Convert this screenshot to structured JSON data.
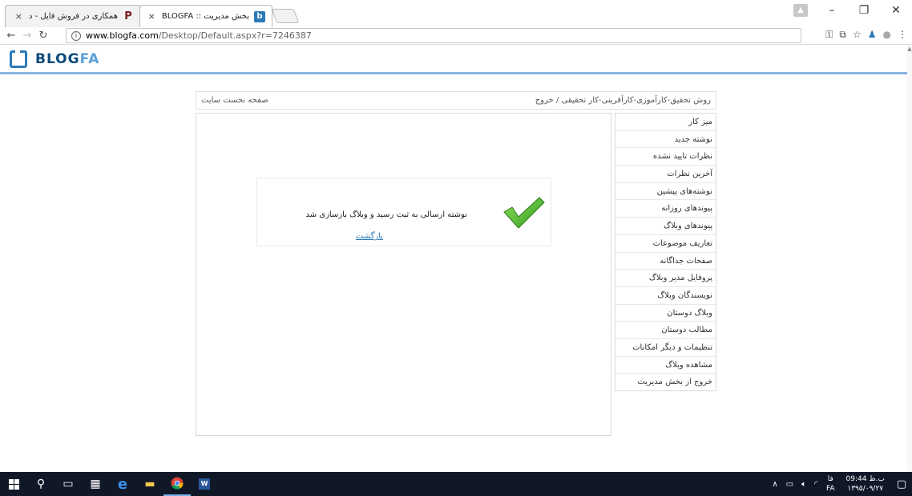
{
  "browser": {
    "tabs": [
      {
        "title": "همکاری در فروش فایل - د",
        "icon": "P",
        "close": "×"
      },
      {
        "title": "بخش مدیریت :: BLOGFA",
        "icon": "b",
        "close": "×"
      }
    ],
    "address": {
      "host": "www.blogfa.com",
      "path": "/Desktop/Default.aspx?r=7246387"
    },
    "window_controls": {
      "minimize": "–",
      "maximize": "❐",
      "close": "✕"
    }
  },
  "site": {
    "logo_blog": "BLOG",
    "logo_fa": "FA"
  },
  "topbar": {
    "blog_title": "روش تحقیق-کارآموزی-کارآفرینی-کار تحقیقی",
    "separator": "/",
    "logout": "خروج",
    "site_home": "صفحه نخست سایت"
  },
  "message": {
    "text": "نوشته ارسالی به ثبت رسید و وبلاگ بازسازی شد",
    "back": "بازگشت"
  },
  "sidebar": {
    "items": [
      "میز کار",
      "نوشته جدید",
      "نظرات تایید نشده",
      "آخرین نظرات",
      "نوشته‌های پیشین",
      "پیوندهای روزانه",
      "پیوندهای وبلاگ",
      "تعاریف موضوعات",
      "صفحات جداگانه",
      "پروفایل مدیر وبلاگ",
      "نویسندگان وبلاگ",
      "وبلاگ دوستان",
      "مطالب دوستان",
      "تنظیمات و دیگر امکانات",
      "مشاهده وبلاگ",
      "خروج از بخش مدیریت"
    ]
  },
  "taskbar": {
    "time": "09:44 ب.ظ",
    "date": "۱۳۹۵/۰۹/۲۷",
    "lang_top": "فا",
    "lang_bottom": "FA"
  },
  "colors": {
    "accent": "#2a7ab8",
    "header_line": "#8ab4e0",
    "taskbar": "#101828"
  }
}
